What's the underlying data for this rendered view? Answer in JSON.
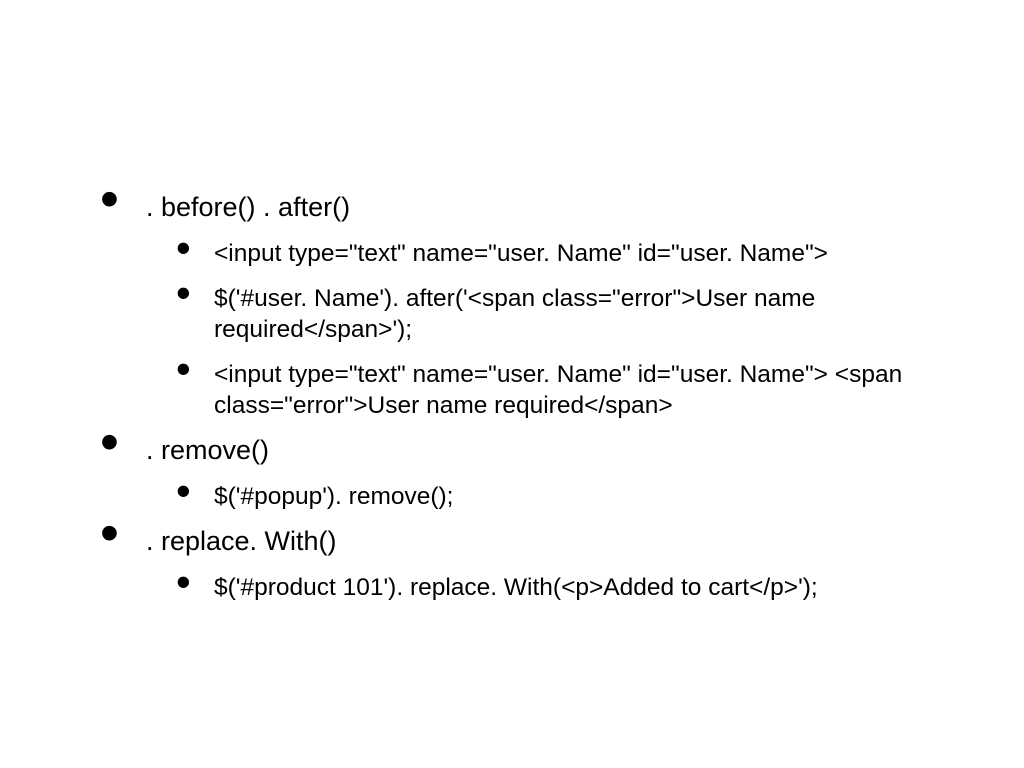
{
  "bullets": {
    "b1": {
      "label": ". before() . after()",
      "sub": {
        "s1": "<input type=\"text\" name=\"user. Name\" id=\"user. Name\">",
        "s2": "$('#user. Name'). after('<span class=\"error\">User name required</span>');",
        "s3": "<input type=\"text\" name=\"user. Name\" id=\"user. Name\"> <span class=\"error\">User name required</span>"
      }
    },
    "b2": {
      "label": ". remove()",
      "sub": {
        "s1": "$('#popup'). remove();"
      }
    },
    "b3": {
      "label": ". replace. With()",
      "sub": {
        "s1": "$('#product 101'). replace. With(<p>Added to cart</p>');"
      }
    }
  }
}
